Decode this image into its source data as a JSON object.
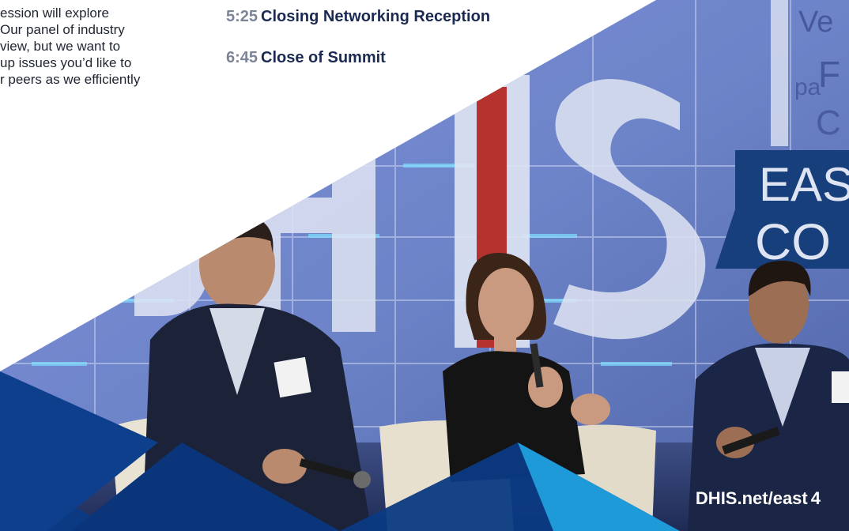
{
  "intro_lines": [
    "ession will explore",
    "Our panel of industry",
    "view, but we want to",
    "up issues you’d like to",
    "r peers as we efficiently"
  ],
  "schedule": [
    {
      "time": "5:25",
      "title": "Closing Networking Reception"
    },
    {
      "time": "6:45",
      "title": "Close of Summit"
    }
  ],
  "photo": {
    "stage_letters": "DHIS",
    "banner_lines": [
      "EAS",
      "CO"
    ],
    "backdrop_text": [
      "Ve",
      "F",
      "pa",
      "C"
    ]
  },
  "footer": {
    "url": "DHIS.net/east",
    "page_number": "4"
  },
  "colors": {
    "navy": "#1b2a52",
    "deep_blue": "#0b3a82",
    "sky_blue": "#1f9ad8",
    "banner_blue": "#163f7c",
    "red_accent": "#b5322e"
  }
}
